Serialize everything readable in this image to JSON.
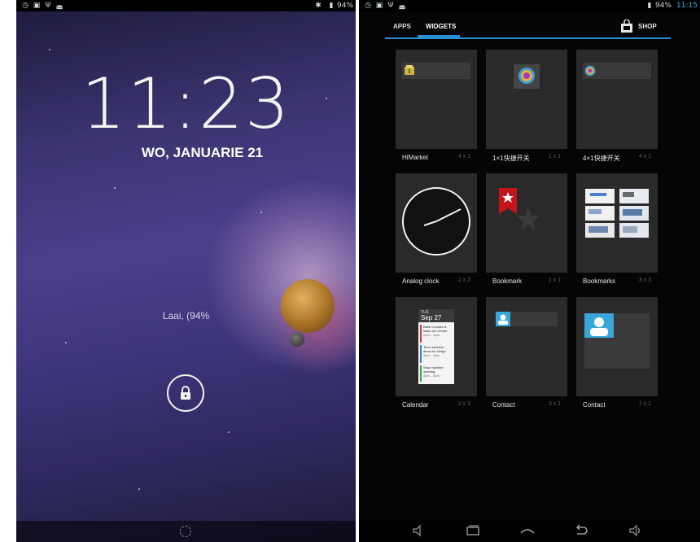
{
  "lock_screen": {
    "time": "11:23",
    "date": "WO, JANUARIE 21",
    "charging_text": "Laai, (94%",
    "status": {
      "battery": "94%"
    }
  },
  "widget_picker": {
    "status": {
      "battery": "94%",
      "time": "11:15"
    },
    "tabs": [
      {
        "label": "APPS",
        "active": false
      },
      {
        "label": "WIDGETS",
        "active": true
      }
    ],
    "shop_label": "SHOP",
    "widgets": [
      {
        "name": "HiMarket",
        "size": "4 x 1"
      },
      {
        "name": "1×1快捷开关",
        "size": "1 x 1"
      },
      {
        "name": "4×1快捷开关",
        "size": "4 x 1"
      },
      {
        "name": "Analog clock",
        "size": "2 x 2"
      },
      {
        "name": "Bookmark",
        "size": "1 x 1"
      },
      {
        "name": "Bookmarks",
        "size": "3 x 3"
      },
      {
        "name": "Calendar",
        "size": "2 x 3"
      },
      {
        "name": "Contact",
        "size": "3 x 1"
      },
      {
        "name": "Contact",
        "size": "1 x 1"
      }
    ],
    "calendar_preview": {
      "day": "TUE",
      "date": "Sep 27",
      "events": [
        {
          "title": "Bake Cookies & Make Ice Cream",
          "time": "2pm – 4pm"
        },
        {
          "title": "Time machine demo for Sergo",
          "time": "2pm – 4pm"
        },
        {
          "title": "Stop machine opening",
          "time": "4pm – 5pm"
        }
      ]
    }
  },
  "colors": {
    "accent": "#2a8fd2",
    "panel": "#2a2a2a",
    "background": "#050505"
  }
}
